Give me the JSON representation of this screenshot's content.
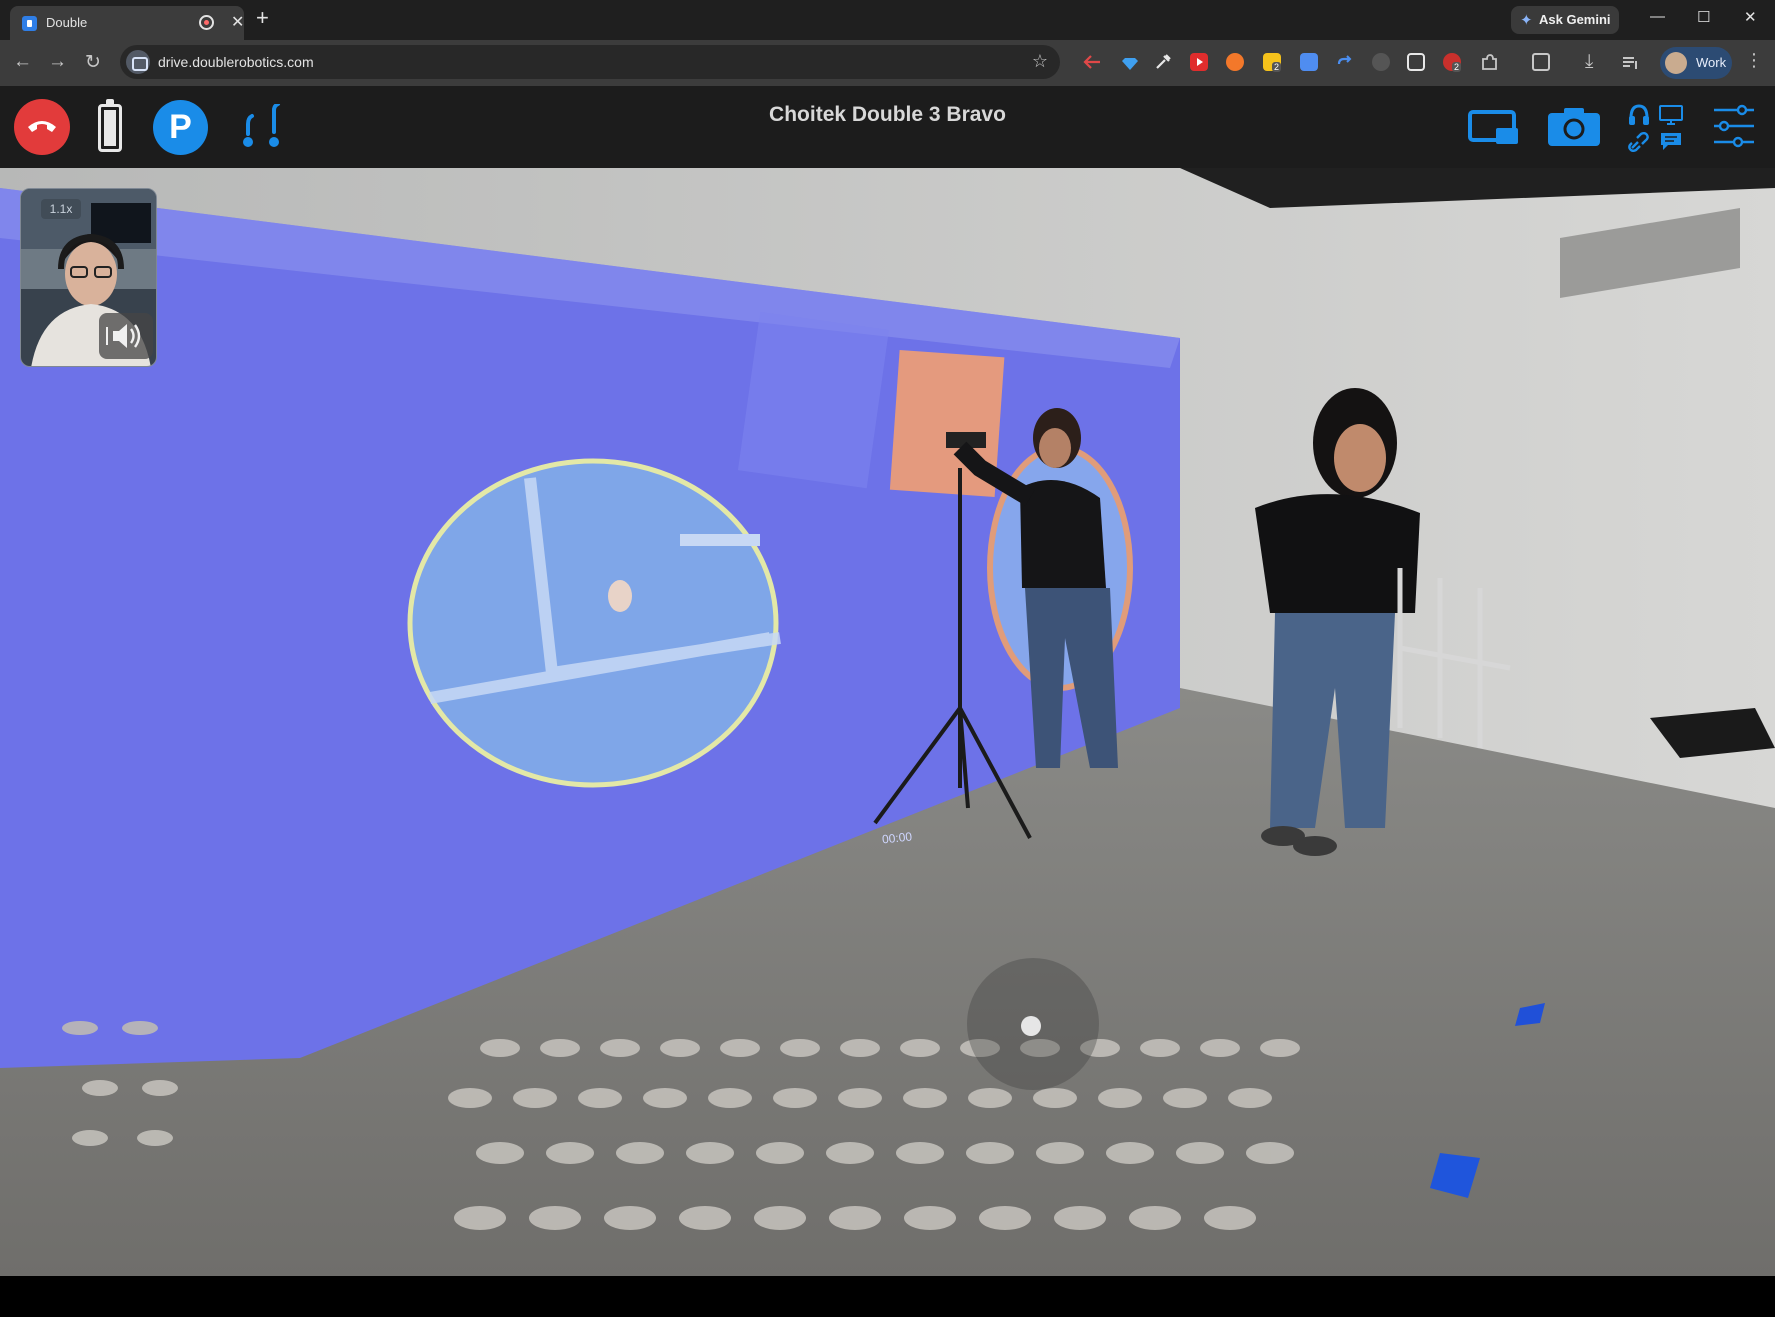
{
  "browser": {
    "tab_title": "Double",
    "new_tab_symbol": "+",
    "tab_close_symbol": "✕",
    "url": "drive.doublerobotics.com",
    "gemini_label": "Ask Gemini",
    "profile_label": "Work",
    "ext_badges": [
      "2",
      "2"
    ],
    "window_controls": [
      "—",
      "☐",
      "✕"
    ]
  },
  "app": {
    "robot_name": "Choitek Double 3 Bravo",
    "park_label": "P",
    "accent_color": "#1a8ce8",
    "hangup_color": "#e23b3b"
  },
  "pip": {
    "zoom_label": "1.1x"
  },
  "video": {
    "timer": "00:00"
  },
  "icons": {
    "back": "←",
    "forward": "→",
    "reload": "↻",
    "star": "☆",
    "menu": "⋮",
    "download": "⤓"
  }
}
